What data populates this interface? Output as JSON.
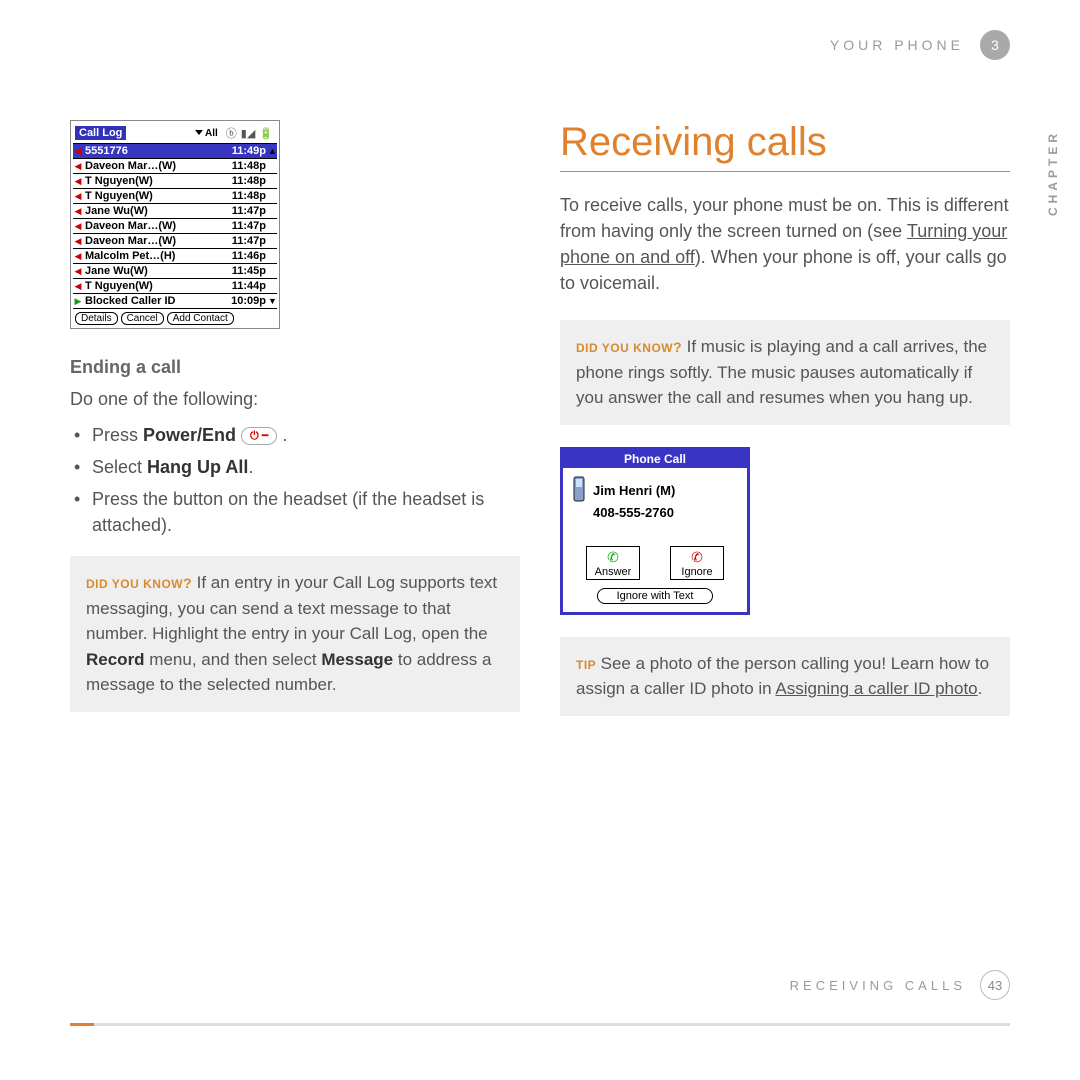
{
  "header": {
    "section": "YOUR PHONE",
    "chapter_num": "3",
    "chapter_side": "CHAPTER"
  },
  "footer": {
    "section": "RECEIVING CALLS",
    "page_num": "43"
  },
  "call_log": {
    "title": "Call Log",
    "filter": "All",
    "btn_details": "Details",
    "btn_cancel": "Cancel",
    "btn_add": "Add Contact",
    "rows": [
      {
        "dir": "out",
        "name": "5551776",
        "time": "11:49p",
        "sel": true,
        "arrow": "▲"
      },
      {
        "dir": "out",
        "name": "Daveon Mar…(W)",
        "time": "11:48p"
      },
      {
        "dir": "out",
        "name": "T Nguyen(W)",
        "time": "11:48p"
      },
      {
        "dir": "out",
        "name": "T Nguyen(W)",
        "time": "11:48p"
      },
      {
        "dir": "out",
        "name": "Jane Wu(W)",
        "time": "11:47p"
      },
      {
        "dir": "out",
        "name": "Daveon Mar…(W)",
        "time": "11:47p"
      },
      {
        "dir": "out",
        "name": "Daveon Mar…(W)",
        "time": "11:47p"
      },
      {
        "dir": "out",
        "name": "Malcolm Pet…(H)",
        "time": "11:46p"
      },
      {
        "dir": "out",
        "name": "Jane Wu(W)",
        "time": "11:45p"
      },
      {
        "dir": "out",
        "name": "T Nguyen(W)",
        "time": "11:44p"
      },
      {
        "dir": "in",
        "name": "Blocked Caller ID",
        "time": "10:09p",
        "arrow": "▼"
      }
    ]
  },
  "left": {
    "ending_heading": "Ending a call",
    "ending_intro": "Do one of the following:",
    "b1_a": "Press ",
    "b1_b": "Power/End",
    "b1_c": " .",
    "b2_a": "Select ",
    "b2_b": "Hang Up All",
    "b2_c": ".",
    "b3": "Press the button on the headset (if the headset is attached).",
    "tip_label": "DID YOU KNOW",
    "tip1_a": "If an entry in your Call Log supports text messaging, you can send a text message to that number. Highlight the entry in your Call Log, open the ",
    "tip1_b": "Record",
    "tip1_c": " menu, and then select ",
    "tip1_d": "Message",
    "tip1_e": " to address a message to the selected number."
  },
  "right": {
    "heading": "Receiving calls",
    "para_a": "To receive calls, your phone must be on. This is different from having only the screen turned on (see ",
    "para_link": "Turning your phone on and off",
    "para_b": "). When your phone is off, your calls go to voicemail.",
    "tip_label": "DID YOU KNOW",
    "dyk": "If music is playing and a call arrives, the phone rings softly. The music pauses automatically if you answer the call and resumes when you hang up.",
    "tip2_label": "TIP",
    "tip2_a": "See a photo of the person calling you! Learn how to assign a caller ID photo in ",
    "tip2_link": "Assigning a caller ID photo",
    "tip2_b": "."
  },
  "phone_call": {
    "title": "Phone Call",
    "name": "Jim Henri (M)",
    "number": "408-555-2760",
    "answer": "Answer",
    "ignore": "Ignore",
    "ignore_text": "Ignore with Text"
  }
}
